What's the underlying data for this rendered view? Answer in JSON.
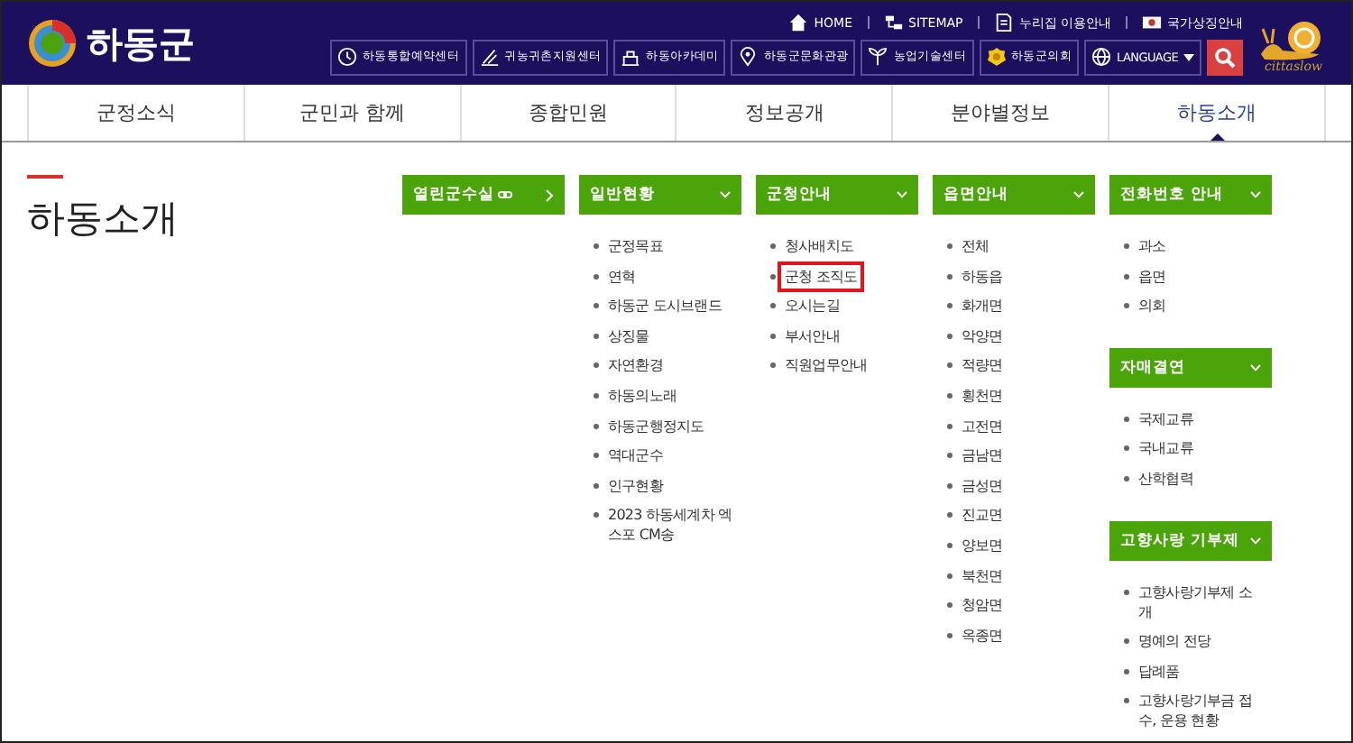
{
  "header": {
    "logo_text": "하동군",
    "top_links": [
      {
        "label": "HOME"
      },
      {
        "label": "SITEMAP"
      },
      {
        "label": "누리집 이용안내"
      },
      {
        "label": "국가상징안내"
      }
    ],
    "buttons": [
      {
        "label": "하동통합예약센터"
      },
      {
        "label": "귀농귀촌지원센터"
      },
      {
        "label": "하동아카데미"
      },
      {
        "label": "하동군문화관광"
      },
      {
        "label": "농업기술센터"
      },
      {
        "label": "하동군의회"
      },
      {
        "label": "LANGUAGE"
      }
    ],
    "cittaslow": "cittaslow"
  },
  "nav": [
    {
      "label": "군정소식",
      "selected": false
    },
    {
      "label": "군민과 함께",
      "selected": false
    },
    {
      "label": "종합민원",
      "selected": false
    },
    {
      "label": "정보공개",
      "selected": false
    },
    {
      "label": "분야별정보",
      "selected": false
    },
    {
      "label": "하동소개",
      "selected": true
    }
  ],
  "page_title": "하동소개",
  "columns": [
    [
      {
        "title": "열린군수실",
        "kind": "link"
      }
    ],
    [
      {
        "title": "일반현황",
        "kind": "menu",
        "items": [
          {
            "label": "군정목표",
            "highlighted": false
          },
          {
            "label": "연혁",
            "highlighted": false
          },
          {
            "label": "하동군 도시브랜드",
            "highlighted": false
          },
          {
            "label": "상징물",
            "highlighted": false
          },
          {
            "label": "자연환경",
            "highlighted": false
          },
          {
            "label": "하동의노래",
            "highlighted": false
          },
          {
            "label": "하동군행정지도",
            "highlighted": false
          },
          {
            "label": "역대군수",
            "highlighted": false
          },
          {
            "label": "인구현황",
            "highlighted": false
          },
          {
            "label": "2023 하동세계차 엑스포 CM송",
            "highlighted": false
          }
        ]
      }
    ],
    [
      {
        "title": "군청안내",
        "kind": "menu",
        "items": [
          {
            "label": "청사배치도",
            "highlighted": false
          },
          {
            "label": "군청 조직도",
            "highlighted": true
          },
          {
            "label": "오시는길",
            "highlighted": false
          },
          {
            "label": "부서안내",
            "highlighted": false
          },
          {
            "label": "직원업무안내",
            "highlighted": false
          }
        ]
      }
    ],
    [
      {
        "title": "읍면안내",
        "kind": "menu",
        "items": [
          {
            "label": "전체",
            "highlighted": false
          },
          {
            "label": "하동읍",
            "highlighted": false
          },
          {
            "label": "화개면",
            "highlighted": false
          },
          {
            "label": "악양면",
            "highlighted": false
          },
          {
            "label": "적량면",
            "highlighted": false
          },
          {
            "label": "횡천면",
            "highlighted": false
          },
          {
            "label": "고전면",
            "highlighted": false
          },
          {
            "label": "금남면",
            "highlighted": false
          },
          {
            "label": "금성면",
            "highlighted": false
          },
          {
            "label": "진교면",
            "highlighted": false
          },
          {
            "label": "양보면",
            "highlighted": false
          },
          {
            "label": "북천면",
            "highlighted": false
          },
          {
            "label": "청암면",
            "highlighted": false
          },
          {
            "label": "옥종면",
            "highlighted": false
          }
        ]
      }
    ],
    [
      {
        "title": "전화번호 안내",
        "kind": "menu",
        "items": [
          {
            "label": "과소",
            "highlighted": false
          },
          {
            "label": "읍면",
            "highlighted": false
          },
          {
            "label": "의회",
            "highlighted": false
          }
        ]
      },
      {
        "title": "자매결연",
        "kind": "menu",
        "items": [
          {
            "label": "국제교류",
            "highlighted": false
          },
          {
            "label": "국내교류",
            "highlighted": false
          },
          {
            "label": "산학협력",
            "highlighted": false
          }
        ]
      },
      {
        "title": "고향사랑 기부제",
        "kind": "menu",
        "items": [
          {
            "label": "고향사랑기부제 소개",
            "highlighted": false
          },
          {
            "label": "명예의 전당",
            "highlighted": false
          },
          {
            "label": "답례품",
            "highlighted": false
          },
          {
            "label": "고향사랑기부금 접수, 운용 현황",
            "highlighted": false
          }
        ]
      }
    ]
  ]
}
